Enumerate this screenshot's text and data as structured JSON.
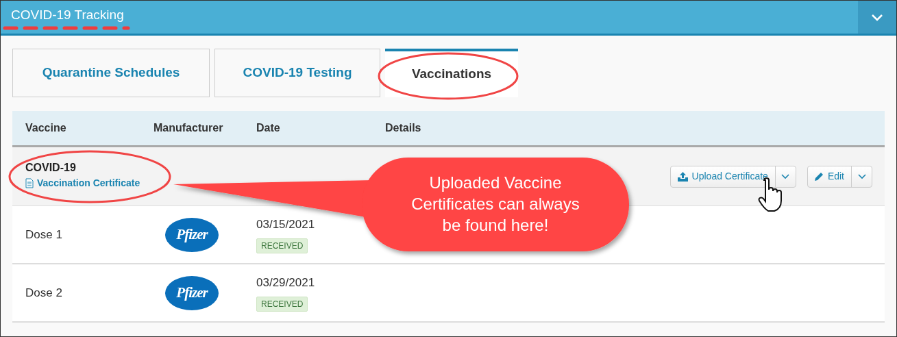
{
  "header": {
    "title": "COVID-19 Tracking"
  },
  "tabs": [
    {
      "label": "Quarantine Schedules",
      "selected": false
    },
    {
      "label": "COVID-19 Testing",
      "selected": false
    },
    {
      "label": "Vaccinations",
      "selected": true
    }
  ],
  "table": {
    "columns": [
      "Vaccine",
      "Manufacturer",
      "Date",
      "Details"
    ],
    "group": {
      "name": "COVID-19",
      "link": "Vaccination Certificate",
      "buttons": [
        "Upload Certificate",
        "Edit"
      ]
    },
    "rows": [
      {
        "vaccine": "Dose 1",
        "manufacturer": "Pfizer",
        "date": "03/15/2021",
        "status": "RECEIVED"
      },
      {
        "vaccine": "Dose 2",
        "manufacturer": "Pfizer",
        "date": "03/29/2021",
        "status": "RECEIVED"
      }
    ]
  },
  "callout": "Uploaded Vaccine Certificates can always be found here!"
}
